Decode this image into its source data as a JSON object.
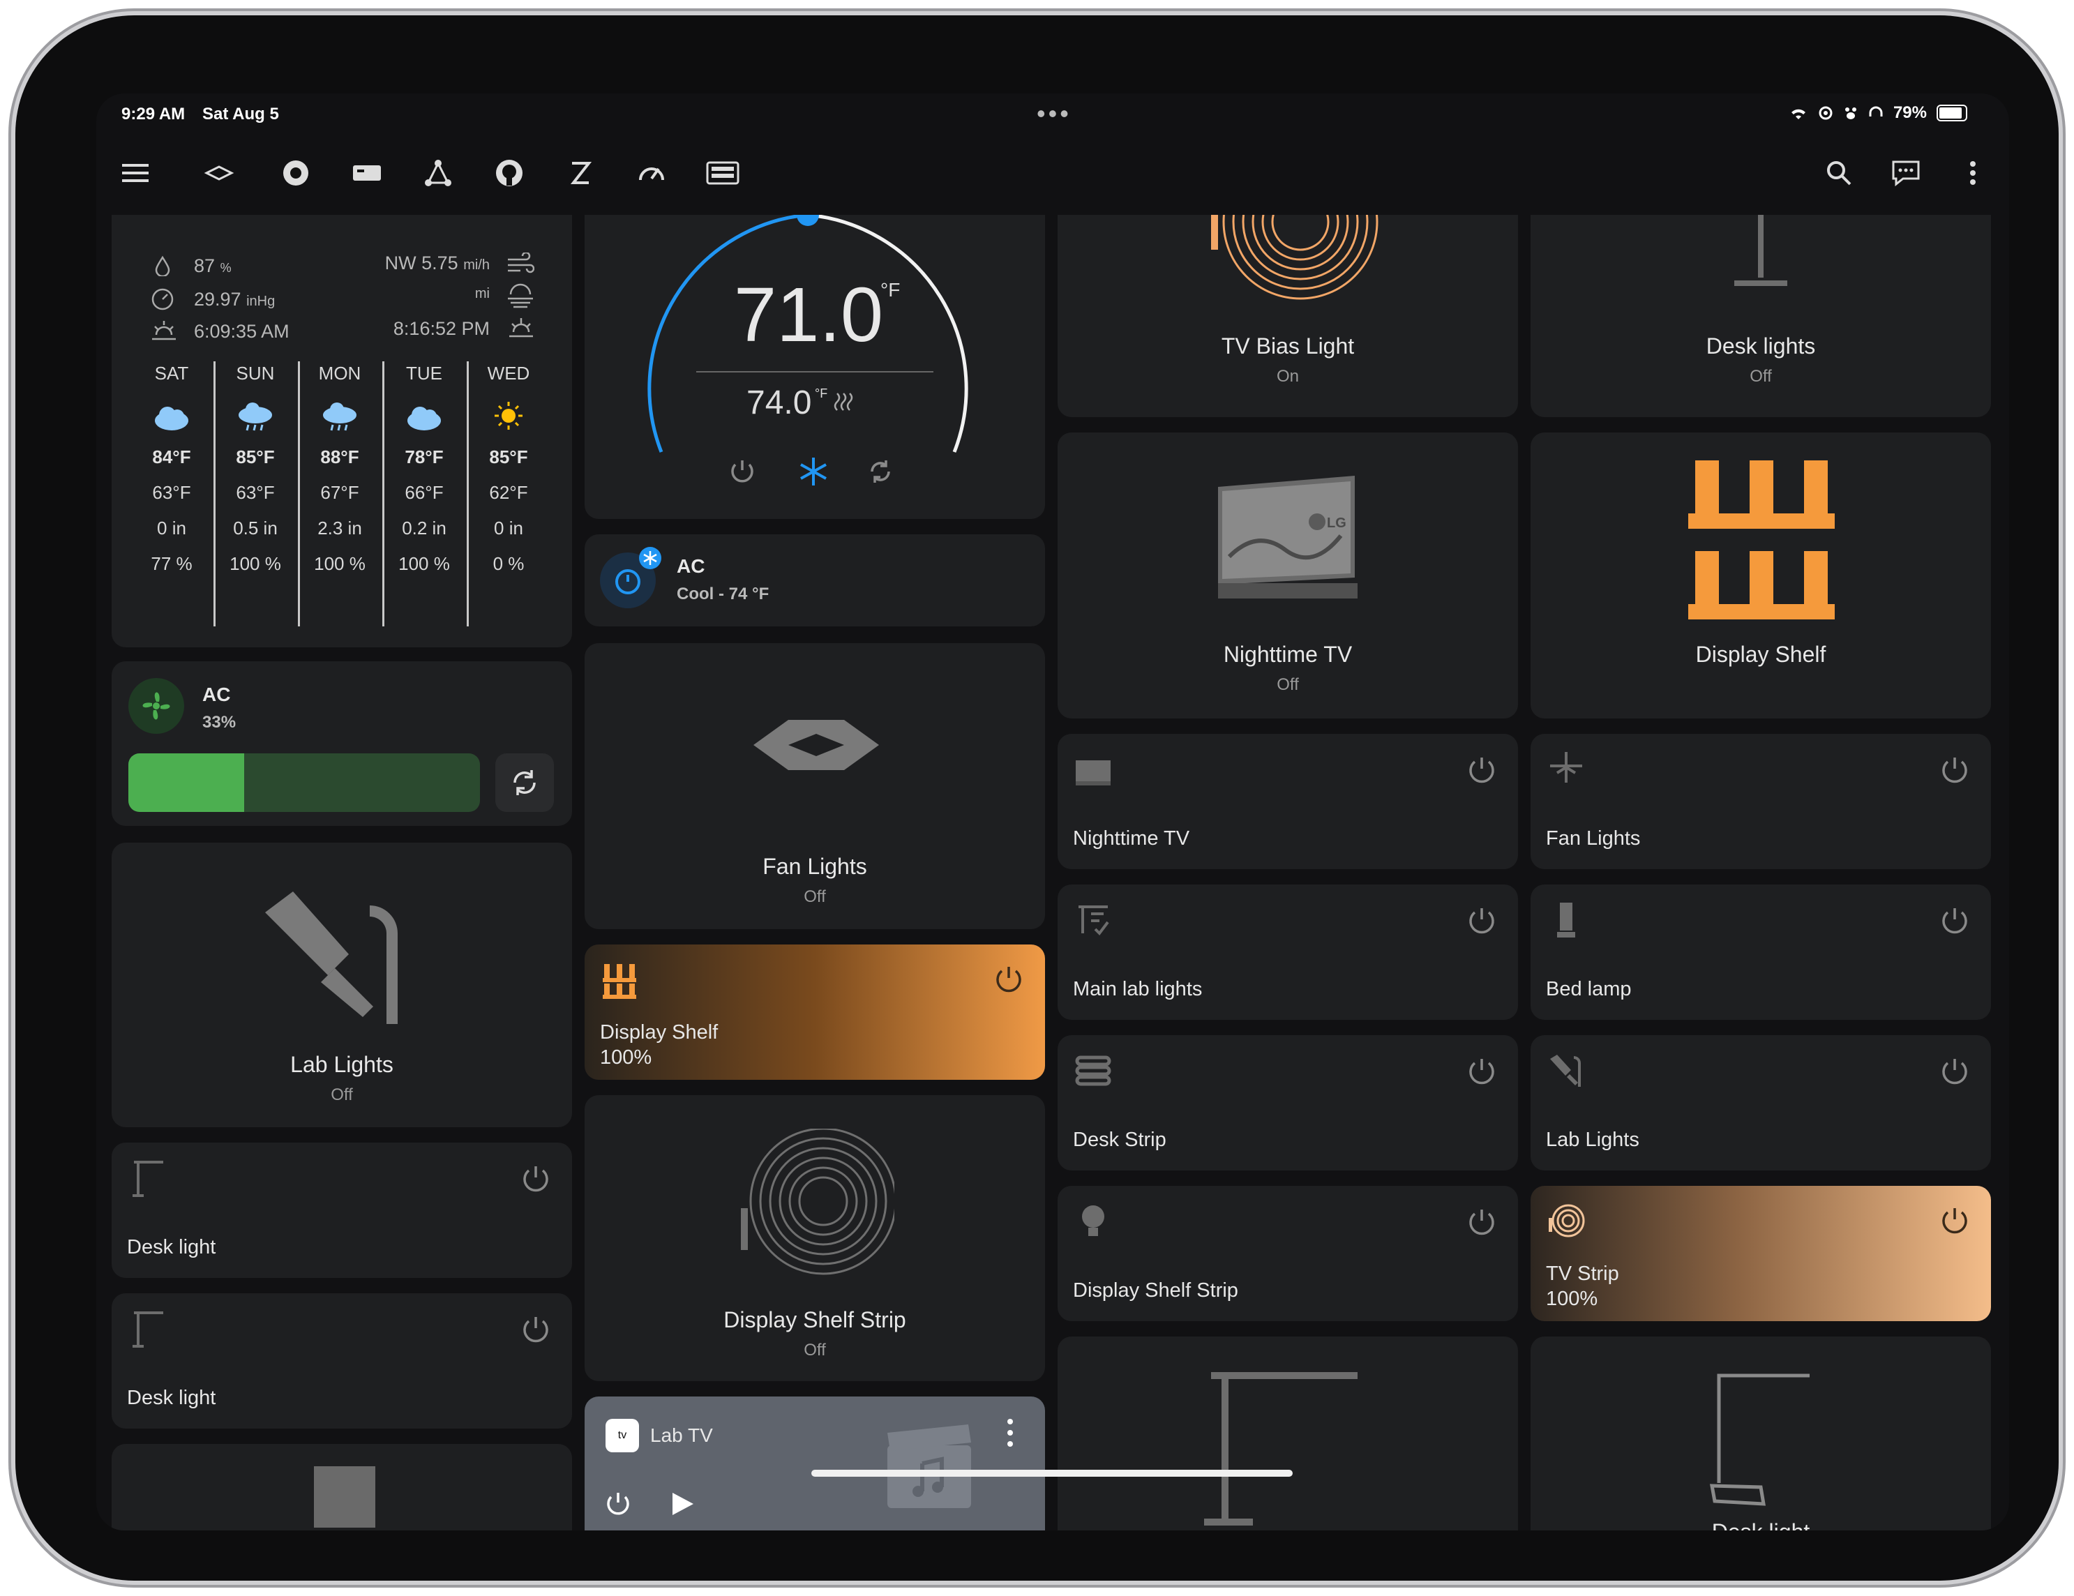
{
  "status": {
    "time": "9:29 AM",
    "date": "Sat Aug 5",
    "battery": "79%"
  },
  "toolbar": {
    "icons": [
      "menu-icon",
      "home-icon",
      "kubernetes-icon",
      "server-icon",
      "network-icon",
      "github-icon",
      "zigbee-icon",
      "speed-icon",
      "keyboard-icon",
      "search-icon",
      "assist-icon",
      "more-icon"
    ]
  },
  "weather": {
    "humidity": "87",
    "humidity_unit": "%",
    "wind": "NW 5.75",
    "wind_unit": "mi/h",
    "pressure": "29.97",
    "pressure_unit": "inHg",
    "visibility_unit": "mi",
    "sunrise": "6:09:35 AM",
    "sunset": "8:16:52 PM",
    "forecast": [
      {
        "day": "SAT",
        "hi": "84°F",
        "lo": "63°F",
        "precip": "0 in",
        "chance": "77 %",
        "icon": "partly-cloudy-icon"
      },
      {
        "day": "SUN",
        "hi": "85°F",
        "lo": "63°F",
        "precip": "0.5 in",
        "chance": "100 %",
        "icon": "rain-icon"
      },
      {
        "day": "MON",
        "hi": "88°F",
        "lo": "67°F",
        "precip": "2.3 in",
        "chance": "100 %",
        "icon": "rain-icon"
      },
      {
        "day": "TUE",
        "hi": "78°F",
        "lo": "66°F",
        "precip": "0.2 in",
        "chance": "100 %",
        "icon": "partly-cloudy-icon"
      },
      {
        "day": "WED",
        "hi": "85°F",
        "lo": "62°F",
        "precip": "0 in",
        "chance": "0 %",
        "icon": "sunny-icon"
      }
    ]
  },
  "fan_card": {
    "name": "AC",
    "percent": "33%",
    "fill": 0.33
  },
  "lab_lights_big": {
    "name": "Lab Lights",
    "state": "Off"
  },
  "desk_light_1": {
    "name": "Desk light"
  },
  "desk_light_2": {
    "name": "Desk light"
  },
  "thermostat": {
    "current": "71.0",
    "unit": "°F",
    "target": "74.0",
    "target_unit": "°F"
  },
  "ac_tile": {
    "name": "AC",
    "state": "Cool - 74 °F"
  },
  "fan_lights_big": {
    "name": "Fan Lights",
    "state": "Off"
  },
  "display_shelf_tile": {
    "name": "Display Shelf",
    "brightness": "100%"
  },
  "display_shelf_strip_big": {
    "name": "Display Shelf Strip",
    "state": "Off"
  },
  "media": {
    "app": "tv",
    "name": "Lab TV"
  },
  "tv_bias": {
    "name": "TV Bias Light",
    "state": "On"
  },
  "nighttime_tv_big": {
    "name": "Nighttime TV",
    "state": "Off",
    "brand": "LG"
  },
  "nighttime_tv_tile": {
    "name": "Nighttime TV"
  },
  "main_lab_lights": {
    "name": "Main lab lights"
  },
  "desk_strip": {
    "name": "Desk Strip"
  },
  "display_shelf_strip_tile": {
    "name": "Display Shelf Strip"
  },
  "desk_lights_big": {
    "name": "Desk lights",
    "state": "Off"
  },
  "display_shelf_big": {
    "name": "Display Shelf"
  },
  "fan_lights_tile": {
    "name": "Fan Lights"
  },
  "bed_lamp": {
    "name": "Bed lamp"
  },
  "lab_lights_tile": {
    "name": "Lab Lights"
  },
  "tv_strip": {
    "name": "TV Strip",
    "brightness": "100%"
  },
  "desk_light_big": {
    "name": "Desk light"
  },
  "colors": {
    "accent_blue": "#2196f3",
    "orange": "#f59a3c",
    "green": "#4caf50",
    "card": "#1e1f21"
  }
}
